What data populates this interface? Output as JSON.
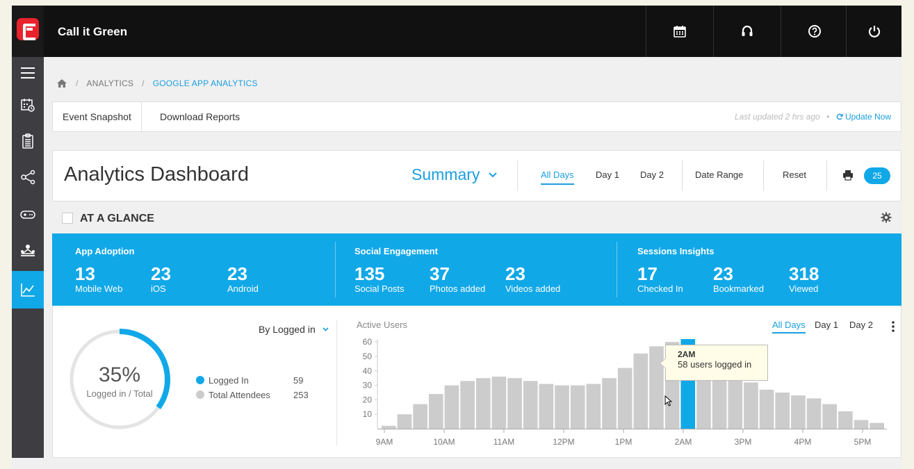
{
  "app": {
    "title": "Call it Green"
  },
  "topbar": {
    "icons": [
      "calendar-icon",
      "headset-icon",
      "help-icon",
      "power-icon"
    ]
  },
  "sidebar": {
    "icons": [
      "menu-icon",
      "event-calendar-icon",
      "clipboard-icon",
      "share-icon",
      "gamepad-icon",
      "meeting-icon",
      "analytics-icon"
    ],
    "active": "analytics-icon"
  },
  "breadcrumb": {
    "level1": "ANALYTICS",
    "level2": "GOOGLE APP ANALYTICS",
    "sep": "/"
  },
  "subnav": {
    "tab1": "Event Snapshot",
    "tab2": "Download Reports",
    "updated": "Last updated 2 hrs ago",
    "bullet": "•",
    "update_now": "Update Now"
  },
  "dashboard": {
    "title": "Analytics Dashboard",
    "view": "Summary",
    "filters": {
      "all_days": "All Days",
      "day1": "Day 1",
      "day2": "Day 2",
      "date_range": "Date Range",
      "reset": "Reset"
    },
    "badge": "25"
  },
  "glance": {
    "label": "AT A GLANCE"
  },
  "stats": {
    "app_adoption": {
      "title": "App Adoption",
      "items": [
        {
          "num": "13",
          "cap": "Mobile Web"
        },
        {
          "num": "23",
          "cap": "iOS"
        },
        {
          "num": "23",
          "cap": "Android"
        }
      ]
    },
    "social": {
      "title": "Social Engagement",
      "items": [
        {
          "num": "135",
          "cap": "Social Posts"
        },
        {
          "num": "37",
          "cap": "Photos added"
        },
        {
          "num": "23",
          "cap": "Videos added"
        }
      ]
    },
    "sessions": {
      "title": "Sessions Insights",
      "items": [
        {
          "num": "17",
          "cap": "Checked In"
        },
        {
          "num": "23",
          "cap": "Bookmarked"
        },
        {
          "num": "318",
          "cap": "Viewed"
        }
      ]
    }
  },
  "login": {
    "percent": "35%",
    "percent_value": 35,
    "caption": "Logged in / Total",
    "dropdown": "By Logged in",
    "legend": [
      {
        "label": "Logged In",
        "value": "59",
        "color": "#11a8e8"
      },
      {
        "label": "Total Attendees",
        "value": "253",
        "color": "#cccccc"
      }
    ]
  },
  "active_users": {
    "title": "Active Users",
    "tabs": {
      "all_days": "All Days",
      "day1": "Day 1",
      "day2": "Day 2"
    },
    "tooltip": {
      "time": "2AM",
      "text": "58 users logged in"
    }
  },
  "chart_data": {
    "type": "bar",
    "title": "Active Users",
    "x_ticks": [
      "9AM",
      "10AM",
      "11AM",
      "12PM",
      "1PM",
      "2AM",
      "3PM",
      "4PM",
      "5PM"
    ],
    "y_ticks": [
      10,
      20,
      30,
      40,
      50,
      60
    ],
    "ylim": [
      0,
      62
    ],
    "values": [
      2,
      10,
      17,
      24,
      30,
      33,
      35,
      36,
      35,
      33,
      31,
      30,
      30,
      31,
      35,
      42,
      52,
      57,
      60,
      62,
      50,
      45,
      41,
      32,
      27,
      25,
      23,
      21,
      17,
      12,
      6,
      4
    ],
    "highlight_index": 19,
    "highlight_color": "#11a8e8",
    "bar_color": "#cccccc"
  }
}
